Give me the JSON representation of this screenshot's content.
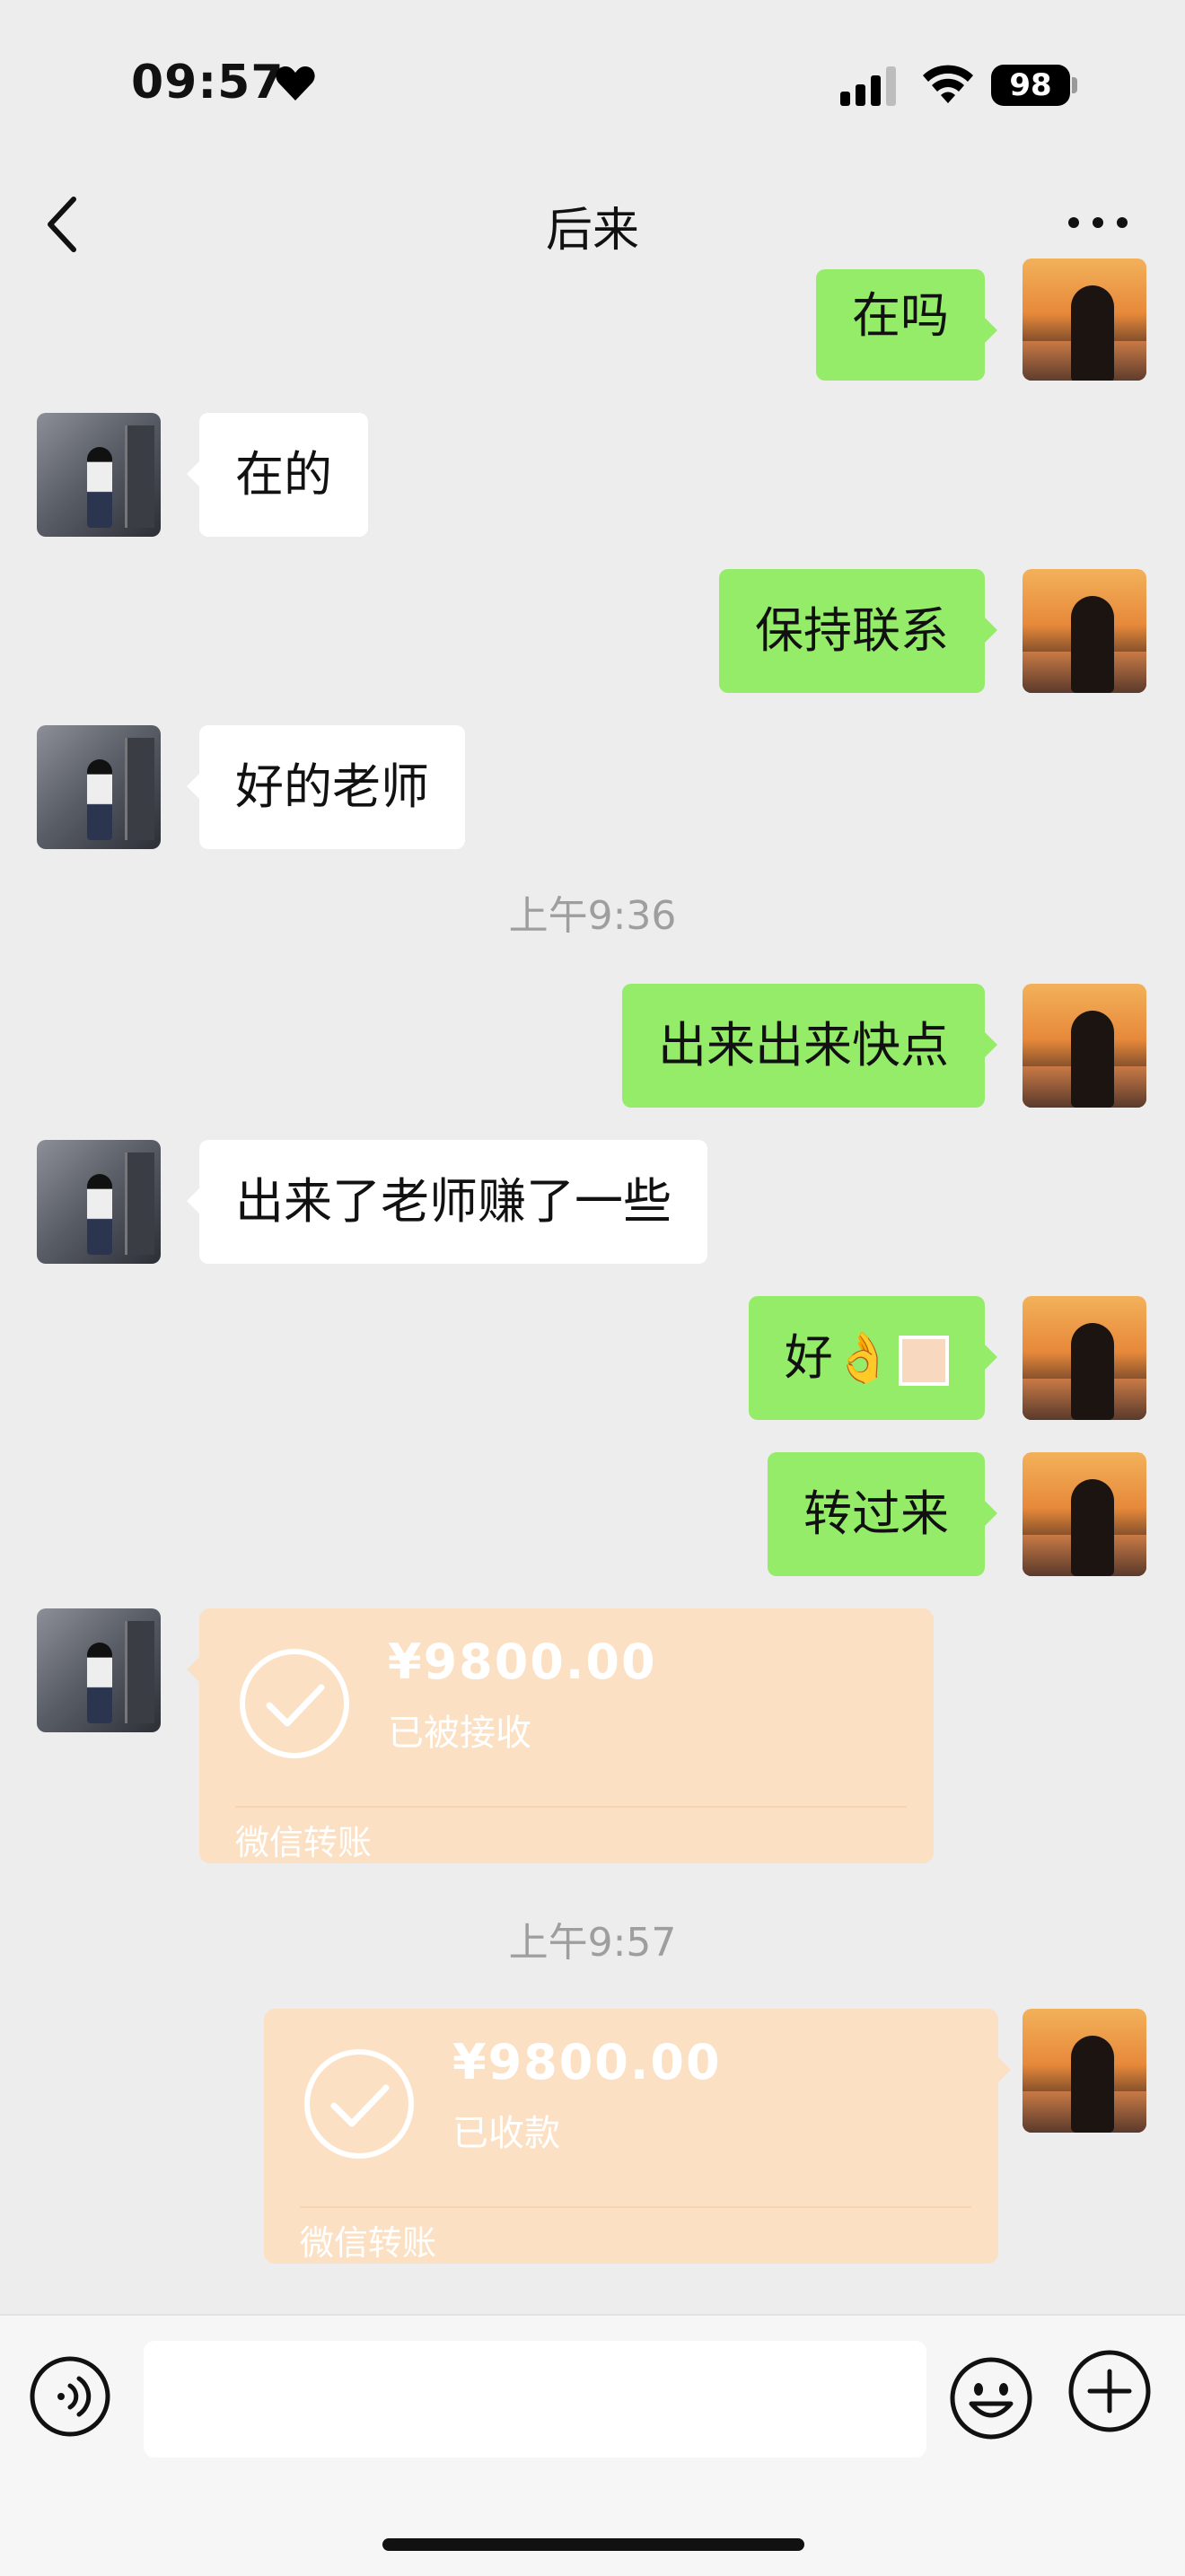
{
  "status_bar": {
    "time": "09:57",
    "battery": "98",
    "icons": [
      "heart-icon",
      "signal-icon",
      "wifi-icon",
      "battery-icon"
    ]
  },
  "nav": {
    "title": "后来",
    "back_icon": "chevron-left-icon",
    "more_icon": "more-dots-icon"
  },
  "messages": [
    {
      "side": "right",
      "text": "在吗"
    },
    {
      "side": "left",
      "text": "在的"
    },
    {
      "side": "right",
      "text": "保持联系"
    },
    {
      "side": "left",
      "text": "好的老师"
    },
    {
      "type": "timestamp",
      "text": "上午9:36"
    },
    {
      "side": "right",
      "text": "出来出来快点"
    },
    {
      "side": "left",
      "text": "出来了老师赚了一些"
    },
    {
      "side": "right",
      "text": "好👌"
    },
    {
      "side": "right",
      "text": "转过来"
    },
    {
      "side": "left",
      "type": "transfer",
      "amount": "¥9800.00",
      "status": "已被接收",
      "label": "微信转账"
    },
    {
      "type": "timestamp",
      "text": "上午9:57"
    },
    {
      "side": "right",
      "type": "transfer",
      "amount": "¥9800.00",
      "status": "已收款",
      "label": "微信转账"
    }
  ],
  "input": {
    "placeholder": "",
    "icons": [
      "voice-icon",
      "emoji-icon",
      "plus-icon"
    ]
  },
  "colors": {
    "background": "#ededed",
    "sent_bubble": "#95ec69",
    "received_bubble": "#ffffff",
    "transfer_card": "#fce0c3"
  }
}
